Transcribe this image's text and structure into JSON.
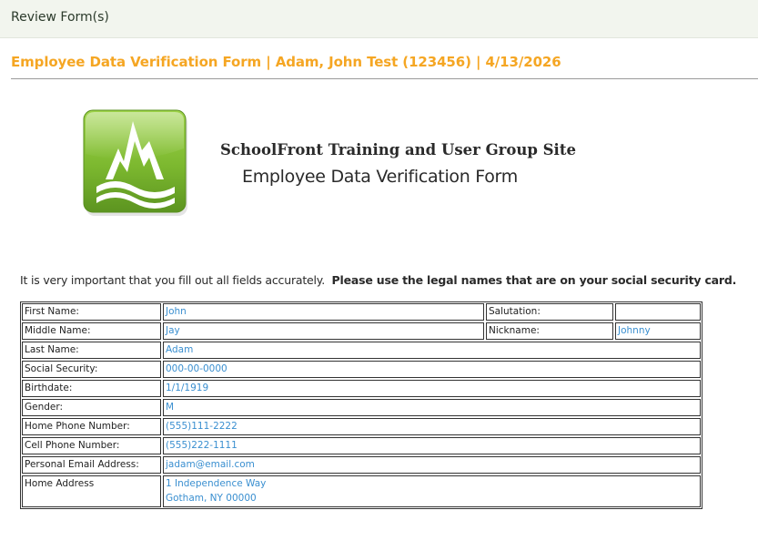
{
  "topbar": {
    "title": "Review Form(s)"
  },
  "form_heading": "Employee Data Verification Form | Adam, John Test (123456) | 4/13/2026",
  "org_name": "SchoolFront Training and User Group Site",
  "form_title": "Employee Data Verification Form",
  "instructions": {
    "normal": "It is very important that you fill out all fields accurately.",
    "bold": "Please use the legal names that are on your social security card."
  },
  "colors": {
    "accent": "#f5a623",
    "value_text": "#3a8fd0",
    "logo_green": "#7cb82f"
  },
  "logo": {
    "icon": "mountain-book-logo-icon"
  },
  "fields": {
    "first_name": {
      "label": "First Name:",
      "value": "John"
    },
    "salutation": {
      "label": "Salutation:",
      "value": ""
    },
    "middle_name": {
      "label": "Middle Name:",
      "value": "Jay"
    },
    "nickname": {
      "label": "Nickname:",
      "value": "Johnny"
    },
    "last_name": {
      "label": "Last Name:",
      "value": "Adam"
    },
    "ssn": {
      "label": "Social Security:",
      "value": "000-00-0000"
    },
    "birthdate": {
      "label": "Birthdate:",
      "value": "1/1/1919"
    },
    "gender": {
      "label": "Gender:",
      "value": "M"
    },
    "home_phone": {
      "label": "Home Phone Number:",
      "value": "(555)111-2222"
    },
    "cell_phone": {
      "label": "Cell Phone Number:",
      "value": "(555)222-1111"
    },
    "email": {
      "label": "Personal Email Address:",
      "value": "jadam@email.com"
    },
    "address": {
      "label": "Home Address",
      "line1": "1 Independence Way",
      "line2": "Gotham, NY 00000"
    }
  }
}
